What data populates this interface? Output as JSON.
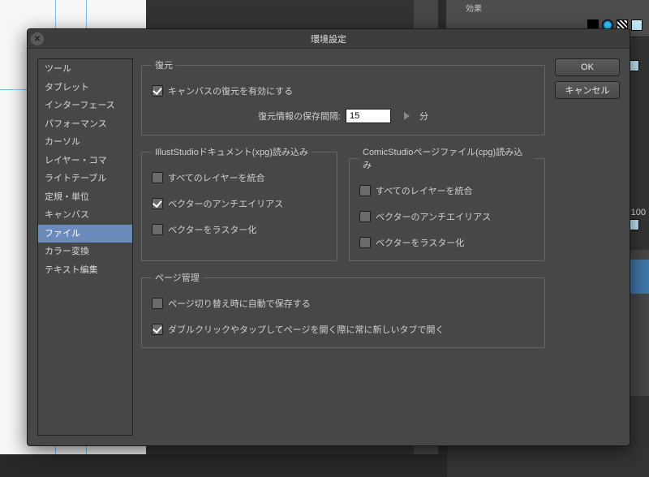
{
  "background": {
    "panel_tab": "効果",
    "value_100": "100"
  },
  "dialog": {
    "title": "環境設定",
    "buttons": {
      "ok": "OK",
      "cancel": "キャンセル"
    },
    "sidebar": {
      "items": [
        "ツール",
        "タブレット",
        "インターフェース",
        "パフォーマンス",
        "カーソル",
        "レイヤー・コマ",
        "ライトテーブル",
        "定規・単位",
        "キャンバス",
        "ファイル",
        "カラー変換",
        "テキスト編集"
      ],
      "selected_index": 9
    },
    "restore": {
      "legend": "復元",
      "enable_label": "キャンバスの復元を有効にする",
      "enable_checked": true,
      "interval_label": "復元情報の保存間隔:",
      "interval_value": "15",
      "interval_unit": "分"
    },
    "illust": {
      "legend": "IllustStudioドキュメント(xpg)読み込み",
      "merge_label": "すべてのレイヤーを統合",
      "merge_checked": false,
      "aa_label": "ベクターのアンチエイリアス",
      "aa_checked": true,
      "raster_label": "ベクターをラスター化",
      "raster_checked": false
    },
    "comic": {
      "legend": "ComicStudioページファイル(cpg)読み込み",
      "merge_label": "すべてのレイヤーを統合",
      "merge_checked": false,
      "aa_label": "ベクターのアンチエイリアス",
      "aa_checked": false,
      "raster_label": "ベクターをラスター化",
      "raster_checked": false
    },
    "page": {
      "legend": "ページ管理",
      "autosave_label": "ページ切り替え時に自動で保存する",
      "autosave_checked": false,
      "newtab_label": "ダブルクリックやタップしてページを開く際に常に新しいタブで開く",
      "newtab_checked": true
    }
  }
}
